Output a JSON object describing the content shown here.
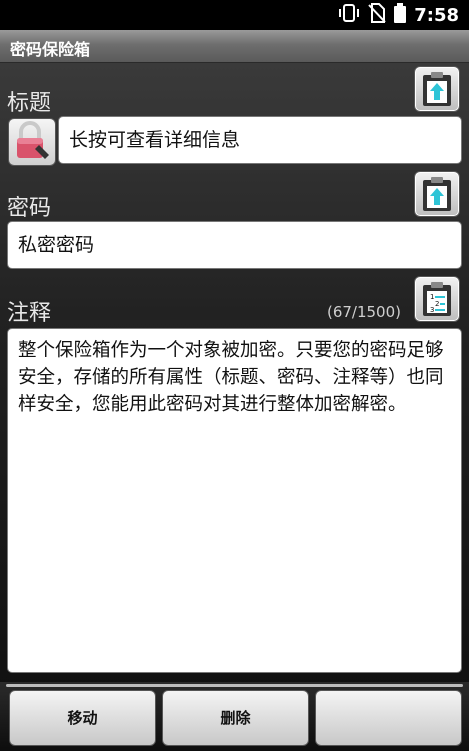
{
  "status": {
    "time": "7:58"
  },
  "app": {
    "title": "密码保险箱"
  },
  "sections": {
    "title_label": "标题",
    "title_value": "长按可查看详细信息",
    "password_label": "密码",
    "password_value": "私密密码",
    "notes_label": "注释",
    "notes_counter": "(67/1500)",
    "notes_value": "整个保险箱作为一个对象被加密。只要您的密码足够安全，存储的所有属性（标题、密码、注释等）也同样安全，您能用此密码对其进行整体加密解密。"
  },
  "buttons": {
    "move": "移动",
    "delete": "删除"
  },
  "icons": {
    "lock": "padlock-icon",
    "paste": "clipboard-paste-icon",
    "numbered": "numbered-list-icon"
  },
  "colors": {
    "title_bar": "#6e6e6e",
    "background": "#1a1a1a",
    "field_bg": "#ffffff",
    "accent_cyan": "#2ec4d6",
    "lock_red": "#d9536b"
  }
}
